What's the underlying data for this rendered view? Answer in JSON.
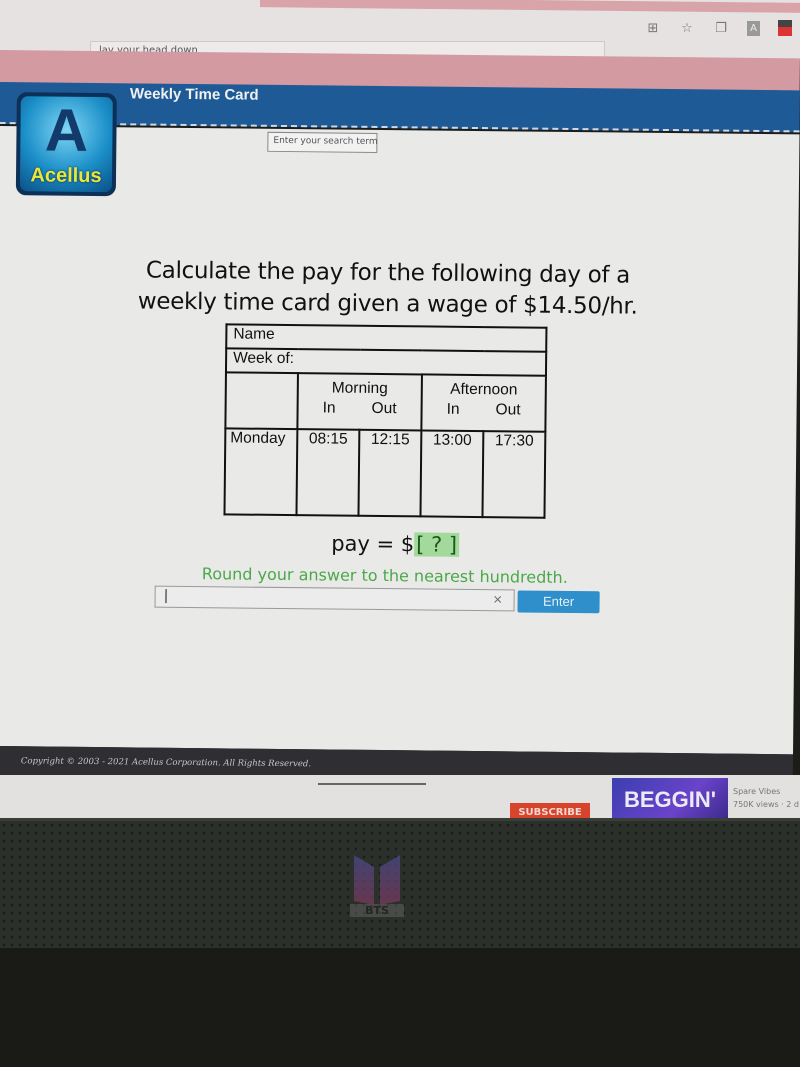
{
  "browser": {
    "background_search_text": "lay your head down",
    "toolbar_icons": [
      "apps-icon",
      "add-favorite-icon",
      "collections-icon",
      "extension-icon",
      "profile-icon"
    ]
  },
  "app": {
    "title": "Weekly Time Card",
    "logo_text": "Acellus",
    "logo_mark": "A",
    "search_placeholder": "Enter your search term"
  },
  "question": {
    "line1": "Calculate the pay for the following day of a",
    "line2": "weekly time card given a wage of $14.50/hr.",
    "wage": "$14.50/hr"
  },
  "timecard": {
    "name_label": "Name",
    "week_label": "Week of:",
    "groups": [
      {
        "label": "Morning",
        "sub": [
          "In",
          "Out"
        ]
      },
      {
        "label": "Afternoon",
        "sub": [
          "In",
          "Out"
        ]
      }
    ],
    "rows": [
      {
        "day": "Monday",
        "morning_in": "08:15",
        "morning_out": "12:15",
        "afternoon_in": "13:00",
        "afternoon_out": "17:30"
      }
    ]
  },
  "answer": {
    "prefix": "pay = $",
    "placeholder": "[ ? ]",
    "hint": "Round your answer to the nearest hundredth.",
    "input_value": "",
    "clear_label": "×",
    "enter_label": "Enter"
  },
  "footer": {
    "copyright": "Copyright © 2003 - 2021 Acellus Corporation.  All Rights Reserved."
  },
  "youtube": {
    "subscribe_label": "SUBSCRIBE",
    "video_thumb_text": "BEGGIN'",
    "channel": "Spare Vibes",
    "views": "750K views · 2 d"
  },
  "monitor": {
    "logo_text": "BTS"
  }
}
